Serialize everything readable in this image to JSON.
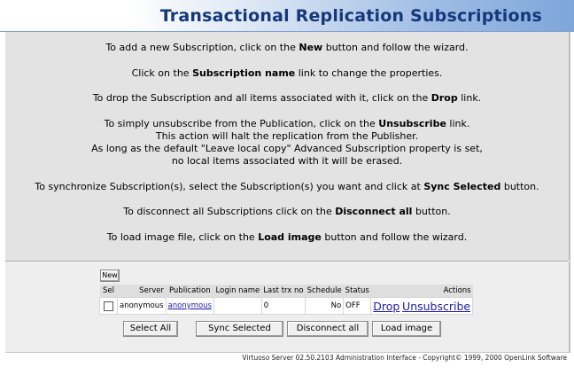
{
  "header": {
    "title": "Transactional Replication Subscriptions"
  },
  "instructions": {
    "p1": {
      "pre": "To add a new Subscription, click on the ",
      "bold": "New",
      "post": " button and follow the wizard."
    },
    "p2": {
      "pre": "Click on the ",
      "bold": "Subscription name",
      "post": " link to change the properties."
    },
    "p3": {
      "pre": "To drop the Subscription and all items associated with it, click on the ",
      "bold": "Drop",
      "post": " link."
    },
    "p4": {
      "pre": "To simply unsubscribe from the Publication, click on the ",
      "bold": "Unsubscribe",
      "post": " link.",
      "line2": "This action will halt the replication from the Publisher.",
      "line3": "As long as the default \"Leave local copy\" Advanced Subscription property is set,",
      "line4": "no local items associated with it will be erased."
    },
    "p5": {
      "pre": "To synchronize Subscription(s), select the Subscription(s) you want and click at ",
      "bold": "Sync Selected",
      "post": " button."
    },
    "p6": {
      "pre": "To disconnect all Subscriptions click on the ",
      "bold": "Disconnect all",
      "post": " button."
    },
    "p7": {
      "pre": "To load image file, click on the ",
      "bold": "Load image",
      "post": " button and follow the wizard."
    }
  },
  "table": {
    "new_button": "New",
    "columns": {
      "sel": "Sel",
      "server": "Server",
      "publication": "Publication",
      "login": "Login name",
      "last_trx": "Last trx no",
      "schedule": "Schedule",
      "status": "Status",
      "actions": "Actions"
    },
    "rows": [
      {
        "checked": false,
        "server": "anonymous",
        "publication": "anonymous",
        "login": "",
        "last_trx": "0",
        "schedule": "No",
        "status": "OFF",
        "drop": "Drop",
        "unsubscribe": "Unsubscribe"
      }
    ]
  },
  "buttons": {
    "select_all": "Select All",
    "sync_selected": "Sync Selected",
    "disconnect_all": "Disconnect all",
    "load_image": "Load image"
  },
  "footer": {
    "text": "Virtuoso Server 02.50.2103 Administration Interface - Copyright© 1999, 2000 OpenLink Software"
  }
}
